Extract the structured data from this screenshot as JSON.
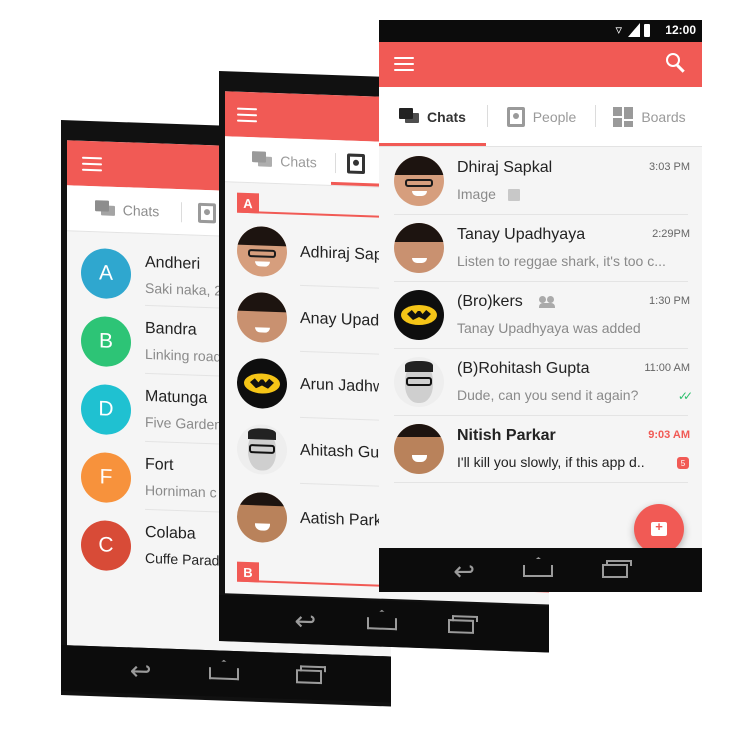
{
  "colors": {
    "accent": "#f15a55",
    "nav_bg": "#0c0c0c",
    "screen_bg": "#f5f5f5"
  },
  "status_bar": {
    "time": "12:00"
  },
  "tabs": {
    "chats": "Chats",
    "people": "People",
    "boards": "Boards"
  },
  "phone1": {
    "rows": [
      {
        "letter": "A",
        "name": "Andheri",
        "sub": "Saki naka, 2",
        "color": "#2fa7cf"
      },
      {
        "letter": "B",
        "name": "Bandra",
        "sub": "Linking road",
        "color": "#2dc476"
      },
      {
        "letter": "D",
        "name": "Matunga",
        "sub": "Five Garden",
        "color": "#1fc1d1"
      },
      {
        "letter": "F",
        "name": "Fort",
        "sub": "Horniman c",
        "color": "#f7923c"
      },
      {
        "letter": "C",
        "name": "Colaba",
        "sub": "Cuffe Parad",
        "color": "#d84b37"
      }
    ]
  },
  "phone2": {
    "section_a": "A",
    "section_b": "B",
    "rows": [
      {
        "name": "Adhiraj Sap"
      },
      {
        "name": "Anay Upadh"
      },
      {
        "name": "Arun Jadhw"
      },
      {
        "name": "Ahitash Gup"
      },
      {
        "name": "Aatish Park"
      }
    ]
  },
  "phone3": {
    "rows": [
      {
        "name": "Dhiraj Sapkal",
        "message": "Image",
        "time": "3:03 PM"
      },
      {
        "name": "Tanay Upadhyaya",
        "message": "Listen to reggae shark, it's too c...",
        "time": "2:29PM"
      },
      {
        "name": "(Bro)kers",
        "message": "Tanay Upadhyaya was added",
        "time": "1:30 PM"
      },
      {
        "name": "(B)Rohitash Gupta",
        "message": "Dude, can you send it again?",
        "time": "11:00 AM"
      },
      {
        "name": "Nitish Parkar",
        "message": "I'll kill you slowly, if this app d..",
        "time": "9:03 AM",
        "unread": "5"
      }
    ]
  }
}
